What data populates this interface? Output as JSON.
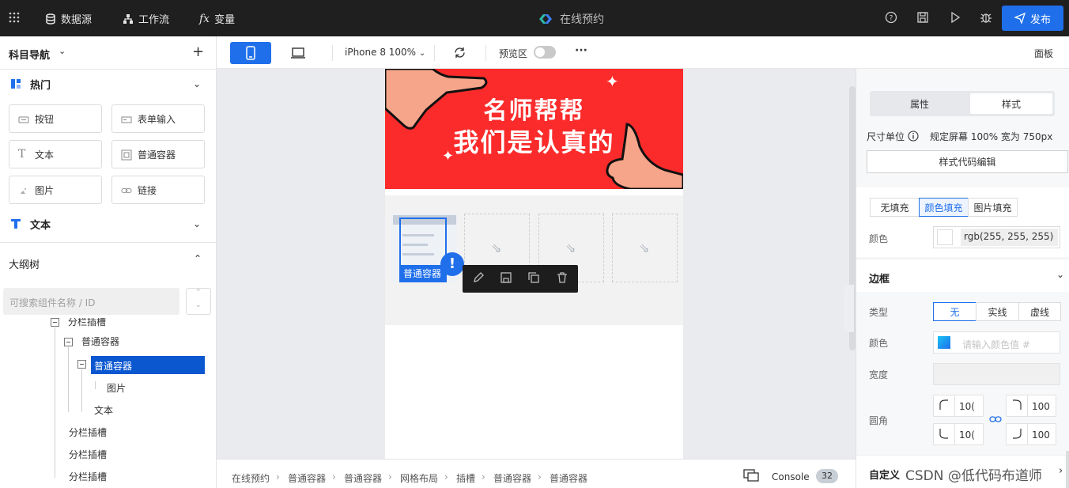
{
  "topbar": {
    "datasource": "数据源",
    "workflow": "工作流",
    "variable": "变量",
    "title": "在线预约",
    "publish": "发布"
  },
  "toolbar": {
    "device": "iPhone 8 100%",
    "preview": "预览区",
    "more": "···",
    "panel": "面板"
  },
  "left": {
    "nav_title": "科目导航",
    "hot_label": "热门",
    "components": [
      "按钮",
      "表单输入",
      "文本",
      "普通容器",
      "图片",
      "链接"
    ],
    "text_label": "文本",
    "outline_title": "大纲树",
    "search_placeholder": "可搜索组件名称 / ID",
    "tree": {
      "partial": "分栏插槽",
      "container1": "普通容器",
      "container2": "普通容器",
      "image": "图片",
      "text": "文本",
      "slot1": "分栏插槽",
      "slot2": "分栏插槽",
      "slot3": "分栏插槽"
    }
  },
  "canvas": {
    "banner_line1": "名师帮帮",
    "banner_line2": "我们是认真的",
    "selected_tag": "普通容器"
  },
  "breadcrumb": {
    "items": [
      "在线预约",
      "普通容器",
      "普通容器",
      "网格布局",
      "插槽",
      "普通容器",
      "普通容器"
    ],
    "console": "Console",
    "console_count": "32"
  },
  "right": {
    "tab_props": "属性",
    "tab_style": "样式",
    "unit_label": "尺寸单位",
    "unit_value": "规定屏幕 100% 宽为 750px",
    "code_edit": "样式代码编辑",
    "fill_none": "无填充",
    "fill_color": "颜色填充",
    "fill_image": "图片填充",
    "color_label": "颜色",
    "color_value": "rgb(255, 255, 255)",
    "border_title": "边框",
    "type_label": "类型",
    "type_none": "无",
    "type_solid": "实线",
    "type_dashed": "虚线",
    "border_color_label": "颜色",
    "border_color_placeholder": "请输入颜色值 #",
    "width_label": "宽度",
    "radius_label": "圆角",
    "radius_tl": "10(",
    "radius_tr": "100",
    "radius_bl": "10(",
    "radius_br": "100",
    "custom_title": "自定义"
  },
  "watermark": "CSDN @低代码布道师",
  "colors": {
    "accent": "#1f6feb",
    "banner": "#fb2b2b",
    "topbar": "#1f1f1f"
  }
}
